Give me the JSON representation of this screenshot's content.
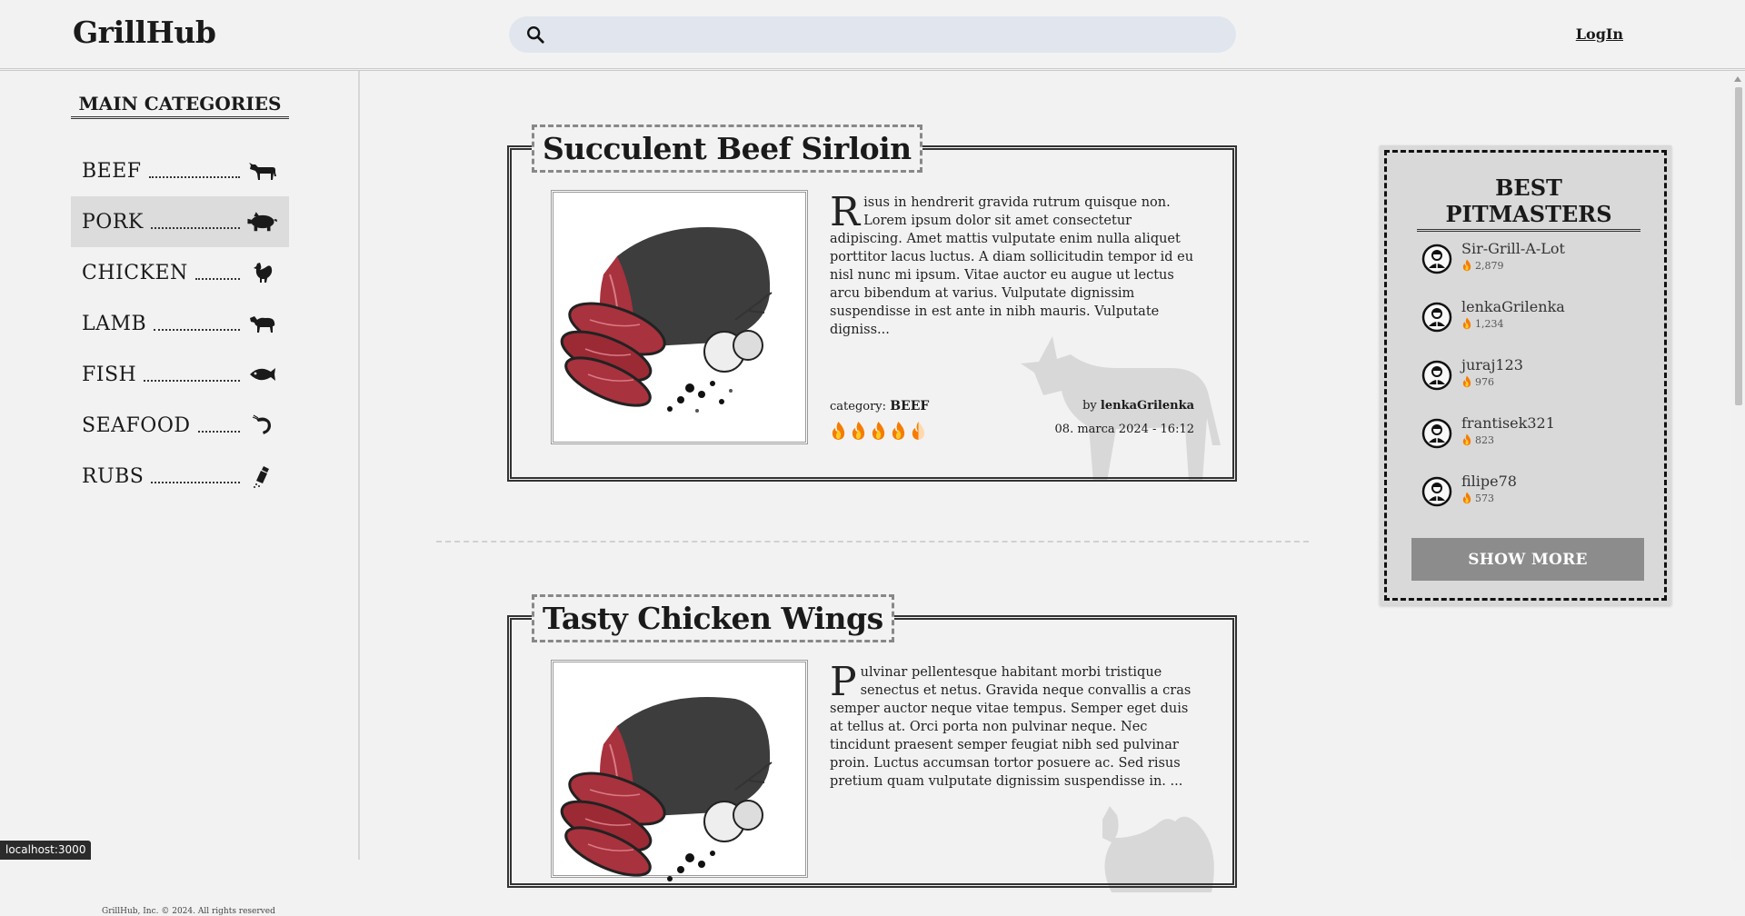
{
  "header": {
    "logo": "GrillHub",
    "search_placeholder": "",
    "login": "LogIn"
  },
  "sidebar": {
    "title": "MAIN CATEGORIES",
    "items": [
      {
        "label": "BEEF",
        "icon": "cow-icon",
        "active": false
      },
      {
        "label": "PORK",
        "icon": "pig-icon",
        "active": true
      },
      {
        "label": "CHICKEN",
        "icon": "chicken-icon",
        "active": false
      },
      {
        "label": "LAMB",
        "icon": "lamb-icon",
        "active": false
      },
      {
        "label": "FISH",
        "icon": "fish-icon",
        "active": false
      },
      {
        "label": "SEAFOOD",
        "icon": "shrimp-icon",
        "active": false
      },
      {
        "label": "RUBS",
        "icon": "shaker-icon",
        "active": false
      }
    ],
    "footer": "GrillHub, Inc. © 2024. All rights reserved"
  },
  "posts": [
    {
      "title": "Succulent Beef Sirloin",
      "drop_cap": "R",
      "text": "isus in hendrerit gravida rutrum quisque non. Lorem ipsum dolor sit amet consectetur adipiscing. Amet mattis vulputate enim nulla aliquet porttitor lacus luctus. A diam sollicitudin tempor id eu nisl nunc mi ipsum. Vitae auctor eu augue ut lectus arcu bibendum at varius. Vulputate dignissim suspendisse in est ante in nibh mauris. Vulputate digniss...",
      "category_label": "category:",
      "category": "BEEF",
      "by_label": "by",
      "author": "lenkaGrilenka",
      "date": "08. marca 2024 - 16:12",
      "rating": 4.5,
      "rating_max": 5,
      "silhouette": "cow-silhouette"
    },
    {
      "title": "Tasty Chicken Wings",
      "drop_cap": "P",
      "text": "ulvinar pellentesque habitant morbi tristique senectus et netus. Gravida neque convallis a cras semper auctor neque vitae tempus. Semper eget duis at tellus at. Orci porta non pulvinar neque. Nec tincidunt praesent semper feugiat nibh sed pulvinar proin. Luctus accumsan tortor posuere ac. Sed risus pretium quam vulputate dignissim suspendisse in. ...",
      "silhouette": "chicken-silhouette"
    }
  ],
  "pitmasters": {
    "title": "BEST PITMASTERS",
    "items": [
      {
        "name": "Sir-Grill-A-Lot",
        "score": "2,879"
      },
      {
        "name": "lenkaGrilenka",
        "score": "1,234"
      },
      {
        "name": "juraj123",
        "score": "976"
      },
      {
        "name": "frantisek321",
        "score": "823"
      },
      {
        "name": "filipe78",
        "score": "573"
      }
    ],
    "show_more": "SHOW MORE"
  },
  "statusbar": "localhost:3000",
  "colors": {
    "background": "#f2f2f2",
    "search_bg": "#e1e6ee",
    "active_category": "#dcdcdc",
    "panel_bg": "#d9d9d9",
    "button_bg": "#8c8c8c",
    "flame_orange": "#f57c00",
    "meat_red": "#a8323d"
  }
}
